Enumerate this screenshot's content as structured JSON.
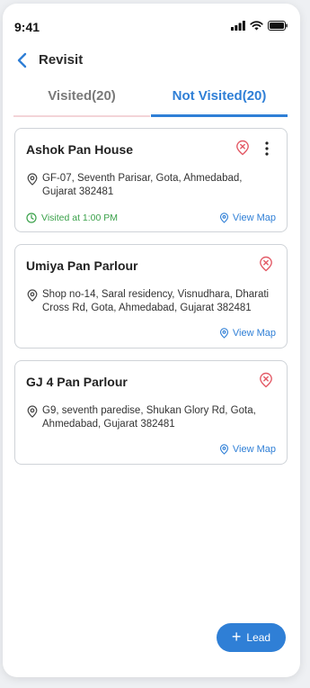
{
  "status": {
    "time": "9:41"
  },
  "header": {
    "title": "Revisit"
  },
  "tabs": [
    {
      "label": "Visited(20)",
      "active": false
    },
    {
      "label": "Not Visited(20)",
      "active": true
    }
  ],
  "cards": [
    {
      "name": "Ashok Pan House",
      "address": "GF-07, Seventh Parisar, Gota, Ahmedabad, Gujarat 382481",
      "visited_at": "Visited at 1:00 PM",
      "view_map": "View Map"
    },
    {
      "name": "Umiya Pan Parlour",
      "address": "Shop no-14, Saral residency, Visnudhara, Dharati Cross Rd, Gota, Ahmedabad, Gujarat 382481",
      "view_map": "View Map"
    },
    {
      "name": "GJ 4 Pan Parlour",
      "address": "G9, seventh paredise, Shukan Glory Rd, Gota, Ahmedabad, Gujarat 382481",
      "view_map": "View Map"
    }
  ],
  "fab": {
    "label": "Lead"
  },
  "colors": {
    "accent": "#2f7fd6",
    "danger": "#e35a66",
    "success": "#3aa14a"
  }
}
